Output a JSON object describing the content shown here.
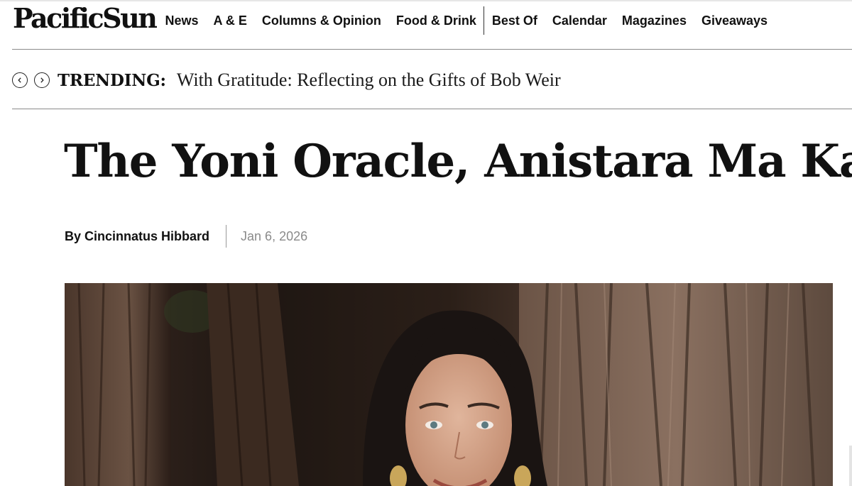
{
  "site": {
    "logo": "PacificSun"
  },
  "nav": {
    "items": [
      {
        "label": "News"
      },
      {
        "label": "A & E"
      },
      {
        "label": "Columns & Opinion"
      },
      {
        "label": "Food & Drink"
      },
      {
        "label": "Best Of"
      },
      {
        "label": "Calendar"
      },
      {
        "label": "Magazines"
      },
      {
        "label": "Giveaways"
      }
    ]
  },
  "trending": {
    "label": "TRENDING:",
    "headline": "With Gratitude: Reflecting on the Gifts of Bob Weir",
    "prev_icon": "chevron-left-icon",
    "next_icon": "chevron-right-icon"
  },
  "article": {
    "title": "The Yoni Oracle, Anistara Ma Ka",
    "author": "By Cincinnatus Hibbard",
    "date": "Jan 6, 2026"
  },
  "colors": {
    "text": "#111111",
    "rule": "#8a8a8a",
    "date": "#8a8a8a"
  }
}
